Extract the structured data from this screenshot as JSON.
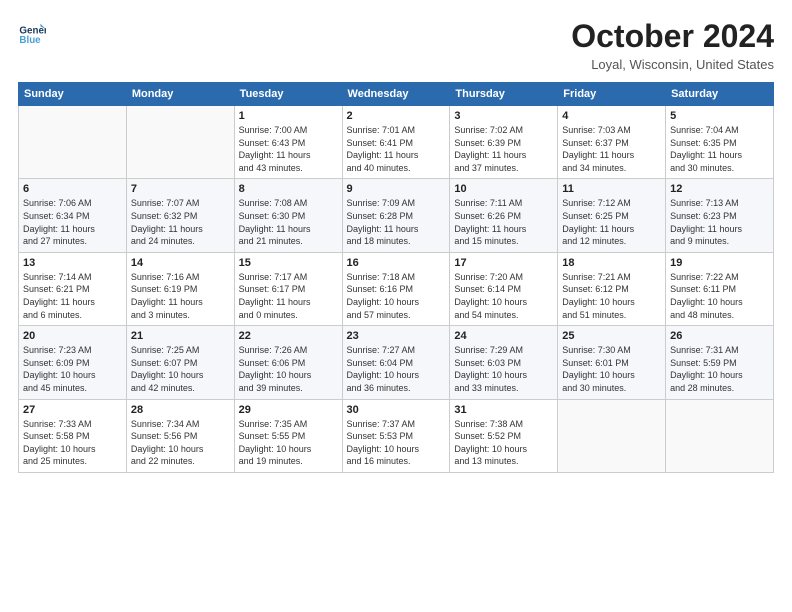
{
  "header": {
    "logo_line1": "General",
    "logo_line2": "Blue",
    "month_title": "October 2024",
    "location": "Loyal, Wisconsin, United States"
  },
  "weekdays": [
    "Sunday",
    "Monday",
    "Tuesday",
    "Wednesday",
    "Thursday",
    "Friday",
    "Saturday"
  ],
  "weeks": [
    [
      {
        "day": "",
        "info": ""
      },
      {
        "day": "",
        "info": ""
      },
      {
        "day": "1",
        "info": "Sunrise: 7:00 AM\nSunset: 6:43 PM\nDaylight: 11 hours\nand 43 minutes."
      },
      {
        "day": "2",
        "info": "Sunrise: 7:01 AM\nSunset: 6:41 PM\nDaylight: 11 hours\nand 40 minutes."
      },
      {
        "day": "3",
        "info": "Sunrise: 7:02 AM\nSunset: 6:39 PM\nDaylight: 11 hours\nand 37 minutes."
      },
      {
        "day": "4",
        "info": "Sunrise: 7:03 AM\nSunset: 6:37 PM\nDaylight: 11 hours\nand 34 minutes."
      },
      {
        "day": "5",
        "info": "Sunrise: 7:04 AM\nSunset: 6:35 PM\nDaylight: 11 hours\nand 30 minutes."
      }
    ],
    [
      {
        "day": "6",
        "info": "Sunrise: 7:06 AM\nSunset: 6:34 PM\nDaylight: 11 hours\nand 27 minutes."
      },
      {
        "day": "7",
        "info": "Sunrise: 7:07 AM\nSunset: 6:32 PM\nDaylight: 11 hours\nand 24 minutes."
      },
      {
        "day": "8",
        "info": "Sunrise: 7:08 AM\nSunset: 6:30 PM\nDaylight: 11 hours\nand 21 minutes."
      },
      {
        "day": "9",
        "info": "Sunrise: 7:09 AM\nSunset: 6:28 PM\nDaylight: 11 hours\nand 18 minutes."
      },
      {
        "day": "10",
        "info": "Sunrise: 7:11 AM\nSunset: 6:26 PM\nDaylight: 11 hours\nand 15 minutes."
      },
      {
        "day": "11",
        "info": "Sunrise: 7:12 AM\nSunset: 6:25 PM\nDaylight: 11 hours\nand 12 minutes."
      },
      {
        "day": "12",
        "info": "Sunrise: 7:13 AM\nSunset: 6:23 PM\nDaylight: 11 hours\nand 9 minutes."
      }
    ],
    [
      {
        "day": "13",
        "info": "Sunrise: 7:14 AM\nSunset: 6:21 PM\nDaylight: 11 hours\nand 6 minutes."
      },
      {
        "day": "14",
        "info": "Sunrise: 7:16 AM\nSunset: 6:19 PM\nDaylight: 11 hours\nand 3 minutes."
      },
      {
        "day": "15",
        "info": "Sunrise: 7:17 AM\nSunset: 6:17 PM\nDaylight: 11 hours\nand 0 minutes."
      },
      {
        "day": "16",
        "info": "Sunrise: 7:18 AM\nSunset: 6:16 PM\nDaylight: 10 hours\nand 57 minutes."
      },
      {
        "day": "17",
        "info": "Sunrise: 7:20 AM\nSunset: 6:14 PM\nDaylight: 10 hours\nand 54 minutes."
      },
      {
        "day": "18",
        "info": "Sunrise: 7:21 AM\nSunset: 6:12 PM\nDaylight: 10 hours\nand 51 minutes."
      },
      {
        "day": "19",
        "info": "Sunrise: 7:22 AM\nSunset: 6:11 PM\nDaylight: 10 hours\nand 48 minutes."
      }
    ],
    [
      {
        "day": "20",
        "info": "Sunrise: 7:23 AM\nSunset: 6:09 PM\nDaylight: 10 hours\nand 45 minutes."
      },
      {
        "day": "21",
        "info": "Sunrise: 7:25 AM\nSunset: 6:07 PM\nDaylight: 10 hours\nand 42 minutes."
      },
      {
        "day": "22",
        "info": "Sunrise: 7:26 AM\nSunset: 6:06 PM\nDaylight: 10 hours\nand 39 minutes."
      },
      {
        "day": "23",
        "info": "Sunrise: 7:27 AM\nSunset: 6:04 PM\nDaylight: 10 hours\nand 36 minutes."
      },
      {
        "day": "24",
        "info": "Sunrise: 7:29 AM\nSunset: 6:03 PM\nDaylight: 10 hours\nand 33 minutes."
      },
      {
        "day": "25",
        "info": "Sunrise: 7:30 AM\nSunset: 6:01 PM\nDaylight: 10 hours\nand 30 minutes."
      },
      {
        "day": "26",
        "info": "Sunrise: 7:31 AM\nSunset: 5:59 PM\nDaylight: 10 hours\nand 28 minutes."
      }
    ],
    [
      {
        "day": "27",
        "info": "Sunrise: 7:33 AM\nSunset: 5:58 PM\nDaylight: 10 hours\nand 25 minutes."
      },
      {
        "day": "28",
        "info": "Sunrise: 7:34 AM\nSunset: 5:56 PM\nDaylight: 10 hours\nand 22 minutes."
      },
      {
        "day": "29",
        "info": "Sunrise: 7:35 AM\nSunset: 5:55 PM\nDaylight: 10 hours\nand 19 minutes."
      },
      {
        "day": "30",
        "info": "Sunrise: 7:37 AM\nSunset: 5:53 PM\nDaylight: 10 hours\nand 16 minutes."
      },
      {
        "day": "31",
        "info": "Sunrise: 7:38 AM\nSunset: 5:52 PM\nDaylight: 10 hours\nand 13 minutes."
      },
      {
        "day": "",
        "info": ""
      },
      {
        "day": "",
        "info": ""
      }
    ]
  ]
}
